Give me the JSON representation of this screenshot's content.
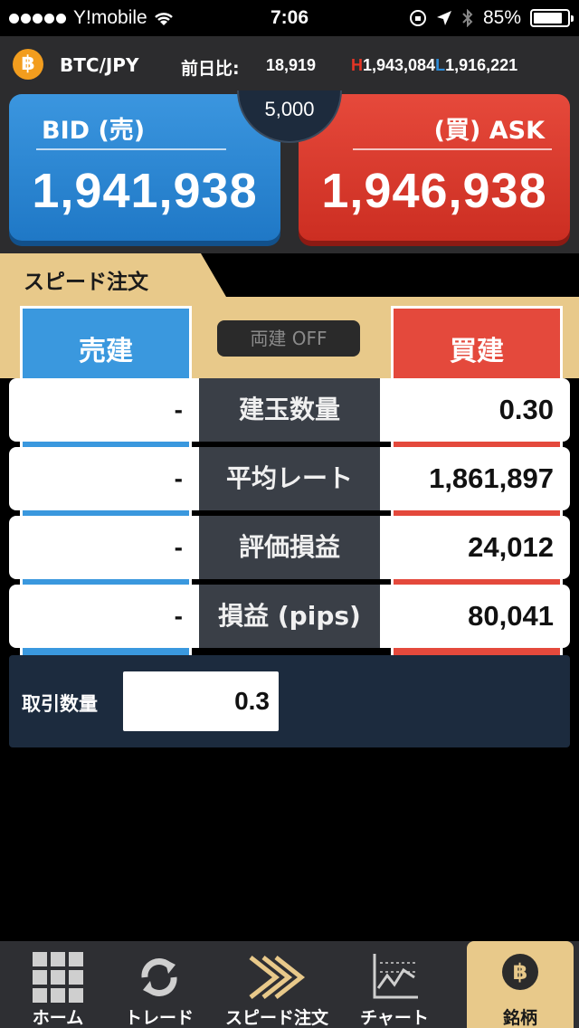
{
  "status_bar": {
    "carrier": "Y!mobile",
    "time": "7:06",
    "battery": "85%",
    "battery_level": 0.85
  },
  "ticker": {
    "coin_symbol": "฿",
    "pair": "BTC/JPY",
    "change_label": "前日比:",
    "change_value": "18,919",
    "high_marker": "H",
    "high_value": "1,943,084",
    "low_marker": "L",
    "low_value": "1,916,221"
  },
  "quotes": {
    "bid_label": "BID (売)",
    "bid_price": "1,941,938",
    "ask_label": "(買) ASK",
    "ask_price": "1,946,938",
    "spread": "5,000"
  },
  "speed_order": {
    "title": "スピード注文",
    "sell_label": "売建",
    "buy_label": "買建",
    "toggle_label": "両建 OFF"
  },
  "stats": [
    {
      "label": "建玉数量",
      "sell": "-",
      "buy": "0.30"
    },
    {
      "label": "平均レート",
      "sell": "-",
      "buy": "1,861,897"
    },
    {
      "label": "評価損益",
      "sell": "-",
      "buy": "24,012"
    },
    {
      "label": "損益 (pips)",
      "sell": "-",
      "buy": "80,041"
    }
  ],
  "quantity": {
    "label": "取引数量",
    "value": "0.3"
  },
  "tabs": [
    {
      "label": "ホーム",
      "icon": "grid-icon"
    },
    {
      "label": "トレード",
      "icon": "refresh-icon"
    },
    {
      "label": "スピード注文",
      "icon": "speed-chevrons-icon"
    },
    {
      "label": "チャート",
      "icon": "chart-icon"
    },
    {
      "label": "銘柄",
      "icon": "bitcoin-icon",
      "badge": "฿"
    }
  ],
  "colors": {
    "bid": "#1f78c6",
    "ask": "#cc2e22",
    "accent": "#e8c98a",
    "panel": "#1c2b3e"
  }
}
